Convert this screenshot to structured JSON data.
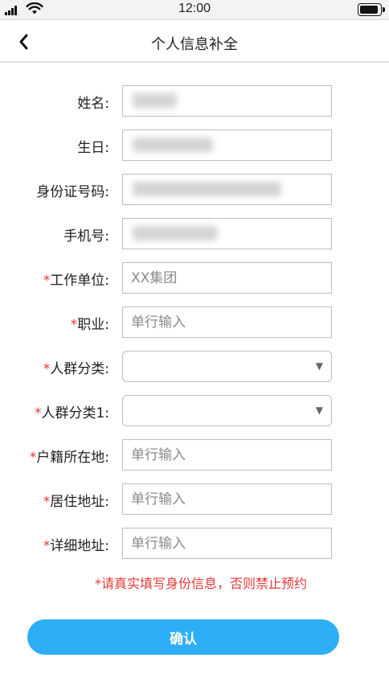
{
  "status_bar": {
    "time": "12:00",
    "battery_level": 0.95
  },
  "nav": {
    "title": "个人信息补全",
    "back_icon": "chevron-left-icon"
  },
  "form": {
    "required_mark": "*",
    "fields": [
      {
        "key": "name",
        "label": "姓名:",
        "required": false,
        "type": "text",
        "value": "",
        "placeholder": "",
        "redacted": true
      },
      {
        "key": "birthday",
        "label": "生日:",
        "required": false,
        "type": "text",
        "value": "",
        "placeholder": "",
        "redacted": true
      },
      {
        "key": "id_number",
        "label": "身份证号码:",
        "required": false,
        "type": "text",
        "value": "",
        "placeholder": "",
        "redacted": true
      },
      {
        "key": "phone",
        "label": "手机号:",
        "required": false,
        "type": "text",
        "value": "",
        "placeholder": "",
        "redacted": true
      },
      {
        "key": "work_unit",
        "label": "工作单位:",
        "required": true,
        "type": "text",
        "value": "",
        "placeholder": "XX集团"
      },
      {
        "key": "occupation",
        "label": "职业:",
        "required": true,
        "type": "text",
        "value": "",
        "placeholder": "单行输入"
      },
      {
        "key": "group_category",
        "label": "人群分类:",
        "required": true,
        "type": "select",
        "value": ""
      },
      {
        "key": "group_category_1",
        "label": "人群分类1:",
        "required": true,
        "type": "select",
        "value": ""
      },
      {
        "key": "household_location",
        "label": "户籍所在地:",
        "required": true,
        "type": "text",
        "value": "",
        "placeholder": "单行输入"
      },
      {
        "key": "residential_address",
        "label": "居住地址:",
        "required": true,
        "type": "text",
        "value": "",
        "placeholder": "单行输入"
      },
      {
        "key": "detailed_address",
        "label": "详细地址:",
        "required": true,
        "type": "text",
        "value": "",
        "placeholder": "单行输入"
      }
    ]
  },
  "notice": "*请真实填写身份信息，否则禁止预约",
  "confirm_label": "确认",
  "colors": {
    "accent": "#2eaef7",
    "required": "#e53935",
    "border": "#bdbdbd"
  }
}
